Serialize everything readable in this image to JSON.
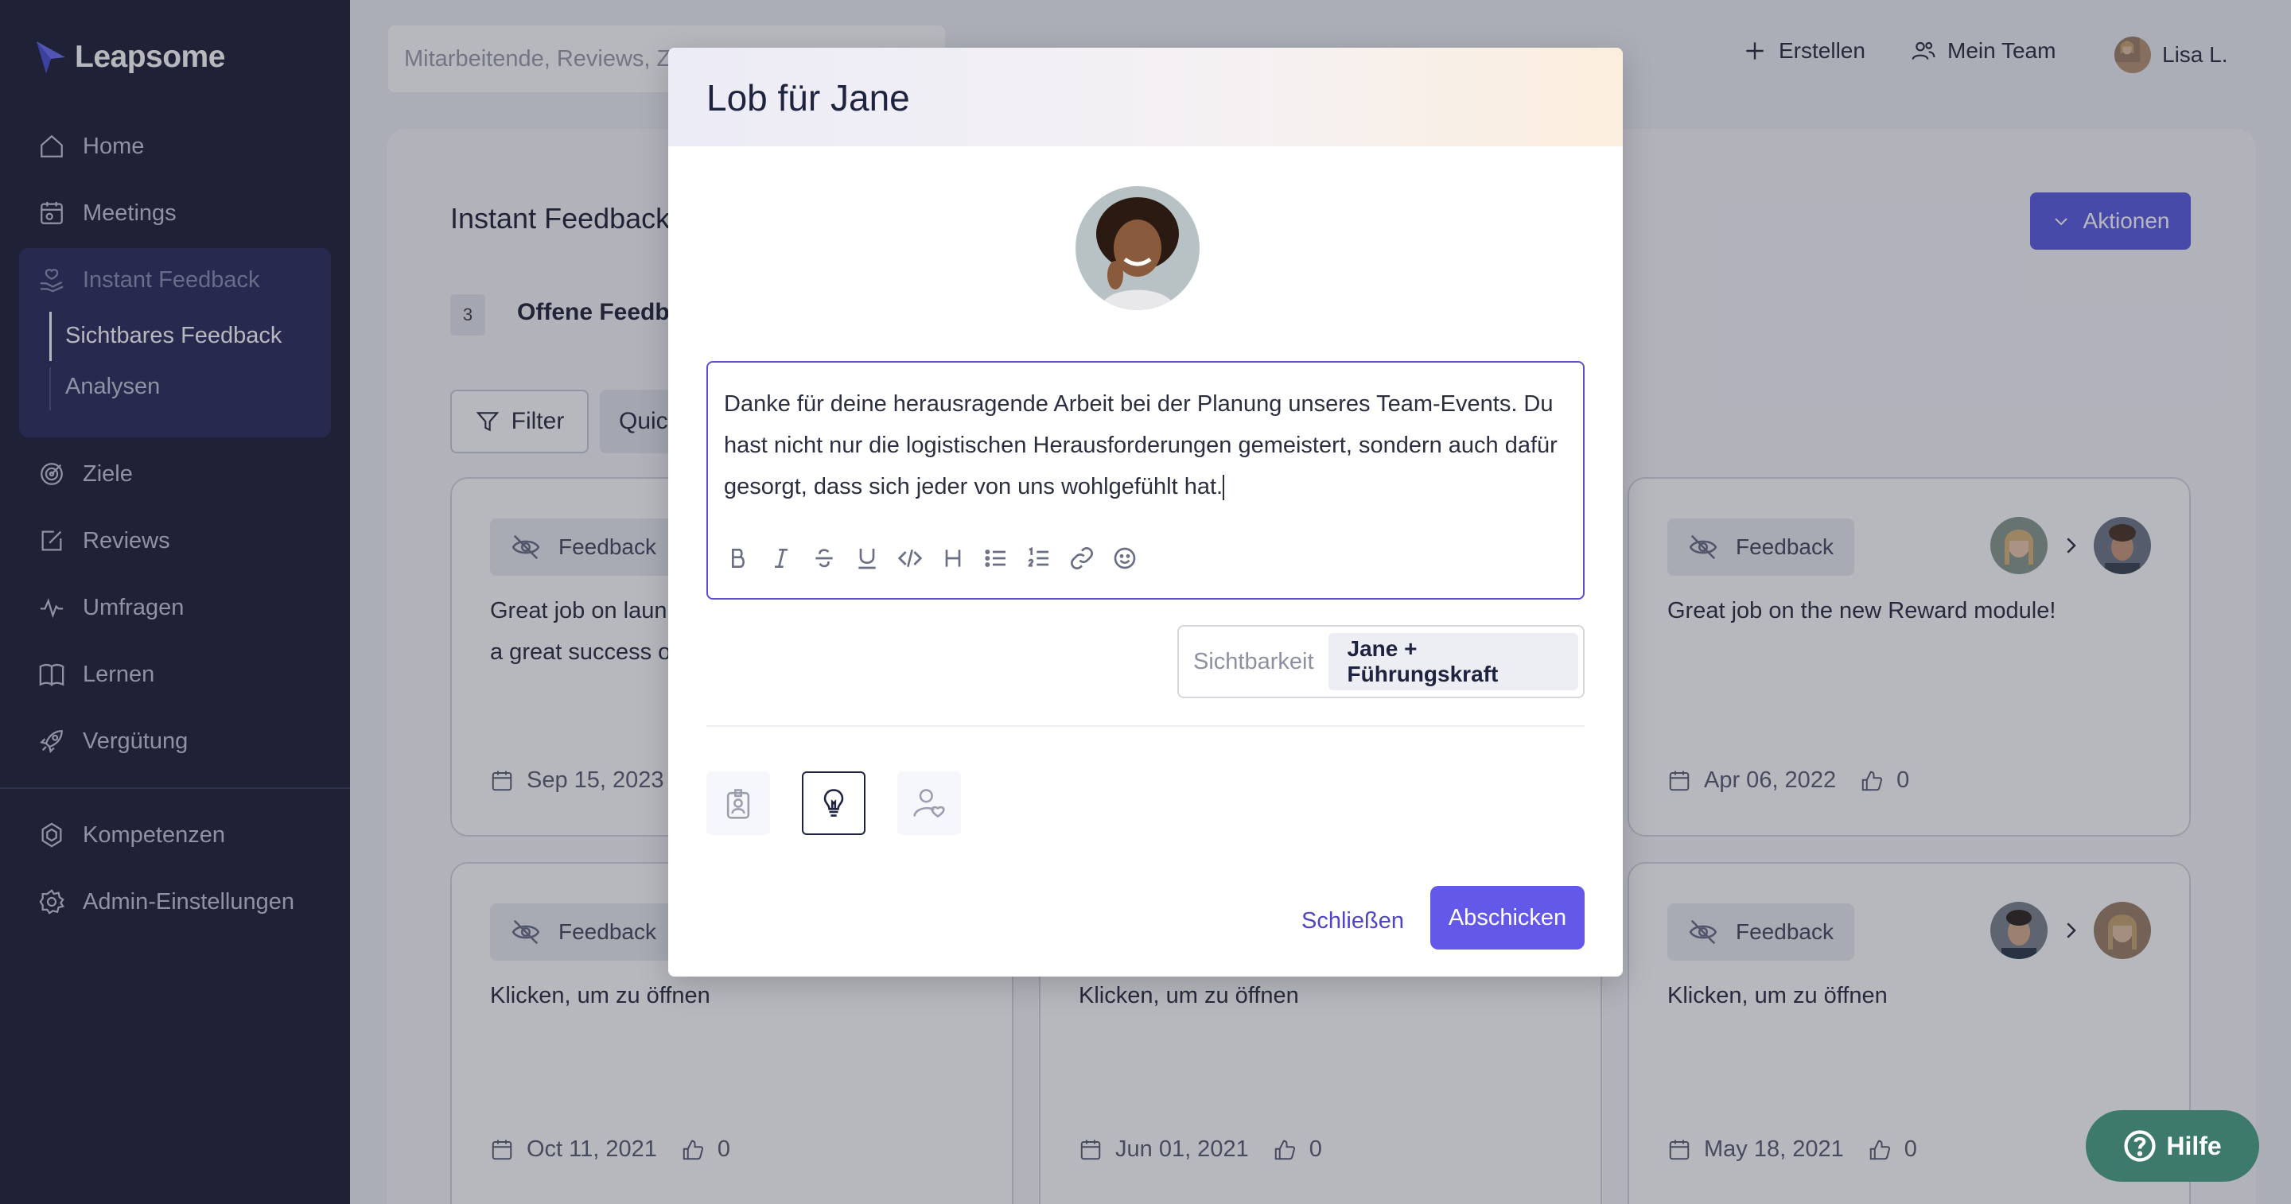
{
  "app": {
    "name": "Leapsome"
  },
  "sidebar": {
    "items": [
      {
        "label": "Home",
        "icon": "home-icon"
      },
      {
        "label": "Meetings",
        "icon": "calendar-icon"
      },
      {
        "label": "Instant Feedback",
        "icon": "hand-heart-icon"
      },
      {
        "label": "Ziele",
        "icon": "target-icon"
      },
      {
        "label": "Reviews",
        "icon": "edit-icon"
      },
      {
        "label": "Umfragen",
        "icon": "pulse-icon"
      },
      {
        "label": "Lernen",
        "icon": "book-icon"
      },
      {
        "label": "Vergütung",
        "icon": "rocket-icon"
      }
    ],
    "sub_items": [
      "Sichtbares Feedback",
      "Analysen"
    ],
    "bottom_items": [
      {
        "label": "Kompetenzen",
        "icon": "competencies-icon"
      },
      {
        "label": "Admin-Einstellungen",
        "icon": "gear-icon"
      }
    ]
  },
  "topbar": {
    "search_placeholder": "Mitarbeitende, Reviews, Z",
    "create_label": "Erstellen",
    "team_label": "Mein Team",
    "user_label": "Lisa L."
  },
  "page": {
    "title": "Instant Feedback",
    "open_count": "3",
    "open_label": "Offene Feedba",
    "actions_label": "Aktionen",
    "filter_label": "Filter",
    "quick_label": "Quic"
  },
  "cards": [
    {
      "tag": "Feedback",
      "text_line1": "Great job on laun",
      "text_line2": "a great success o",
      "date": "Sep 15, 2023",
      "likes": ""
    },
    {
      "tag": "Feedback",
      "text_line1": "Great job on the new Reward module!",
      "text_line2": "",
      "date": "Apr 06, 2022",
      "likes": "0"
    },
    {
      "tag": "Feedback",
      "text_line1": "Klicken, um zu öffnen",
      "text_line2": "",
      "date": "Oct 11, 2021",
      "likes": "0"
    },
    {
      "tag": "",
      "text_line1": "Klicken, um zu öffnen",
      "text_line2": "",
      "date": "Jun 01, 2021",
      "likes": "0"
    },
    {
      "tag": "Feedback",
      "text_line1": "Klicken, um zu öffnen",
      "text_line2": "",
      "date": "May 18, 2021",
      "likes": "0"
    }
  ],
  "modal": {
    "title": "Lob für Jane",
    "editor_text": "Danke für deine herausragende Arbeit bei der Planung unseres Team-Events. Du hast nicht nur die logistischen Herausforderungen gemeistert, sondern auch dafür gesorgt, dass sich jeder von uns wohlgefühlt hat.",
    "toolbar_icons": [
      "bold-icon",
      "italic-icon",
      "strikethrough-icon",
      "underline-icon",
      "code-icon",
      "heading-icon",
      "bullet-list-icon",
      "numbered-list-icon",
      "link-icon",
      "emoji-icon"
    ],
    "visibility_label": "Sichtbarkeit",
    "visibility_value": "Jane + Führungskraft",
    "feedback_types": [
      "badge-icon",
      "lightbulb-icon",
      "person-heart-icon"
    ],
    "selected_type": "lightbulb-icon",
    "close_label": "Schließen",
    "submit_label": "Abschicken"
  },
  "help": {
    "label": "Hilfe"
  },
  "colors": {
    "sidebar_bg": "#1f2138",
    "sidebar_active": "#2c2f5a",
    "primary": "#5c5ee0",
    "submit": "#6358e8",
    "help": "#3e7a6b"
  }
}
